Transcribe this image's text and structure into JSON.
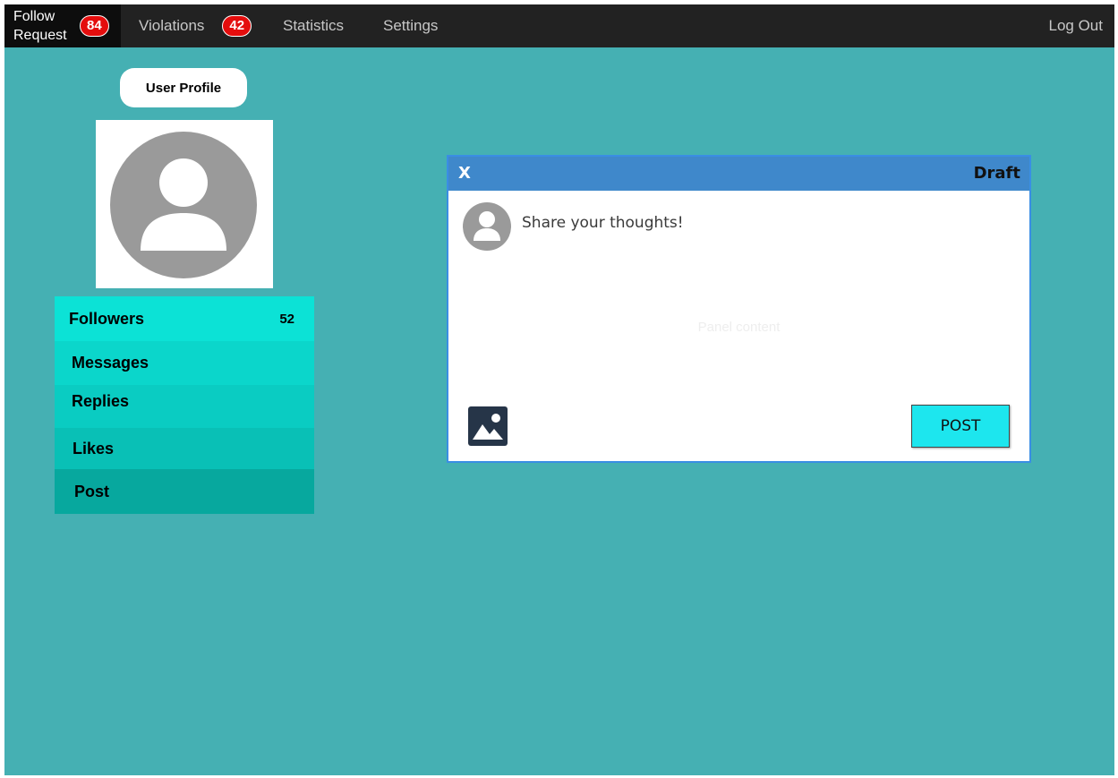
{
  "topnav": {
    "follow_request": {
      "label": "Follow Request",
      "count": "84"
    },
    "violations": {
      "label": "Violations",
      "count": "42"
    },
    "statistics": "Statistics",
    "settings": "Settings",
    "logout": "Log Out"
  },
  "profile": {
    "button_label": "User Profile"
  },
  "menu": {
    "items": [
      {
        "label": "Followers",
        "count": "52"
      },
      {
        "label": "Messages"
      },
      {
        "label": "Replies"
      },
      {
        "label": "Likes"
      },
      {
        "label": "Post"
      }
    ]
  },
  "panel": {
    "close_label": "X",
    "title": "Draft",
    "input_placeholder": "Share your thoughts!",
    "content_text": "Panel content",
    "post_label": "POST",
    "image_icon": "image-icon"
  },
  "colors": {
    "background": "#45b0b3",
    "nav": "#222222",
    "badge": "#e40d0d",
    "panel_header": "#3f88cb",
    "post_button": "#1de6ee"
  }
}
